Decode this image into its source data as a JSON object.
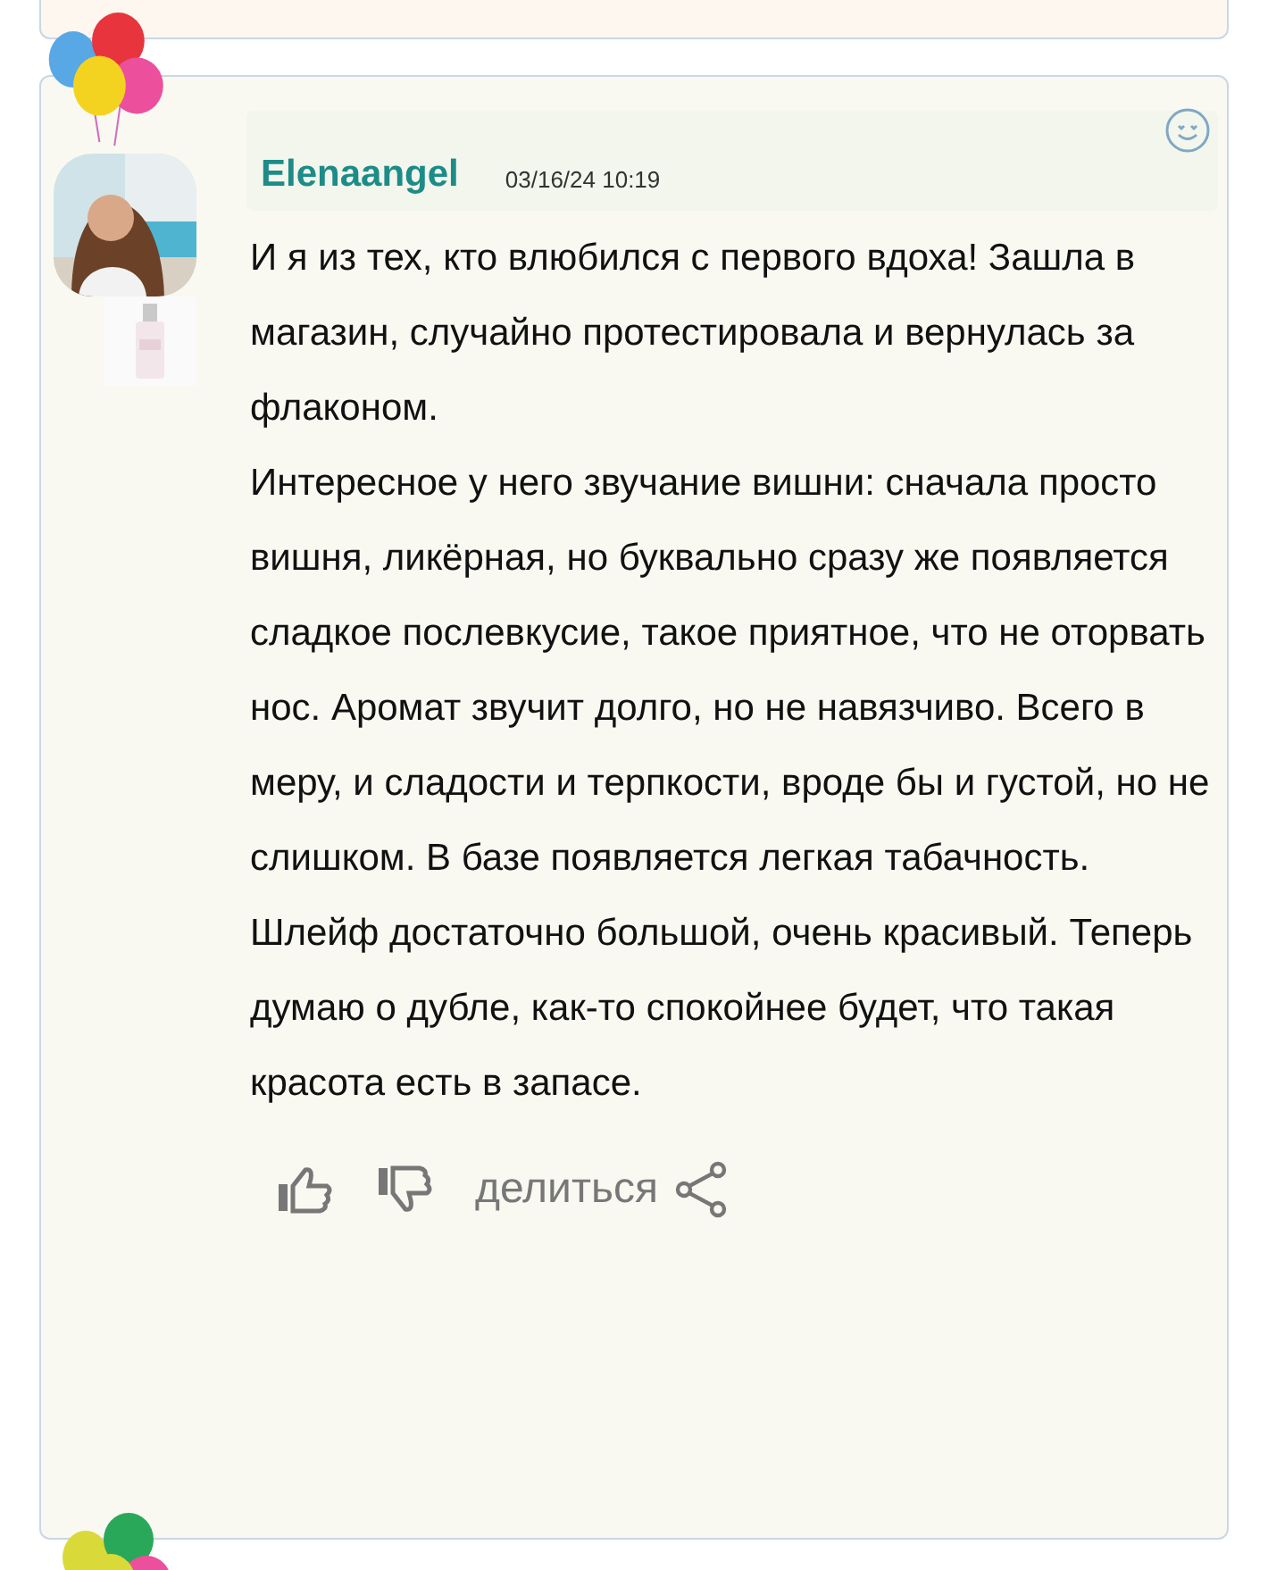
{
  "comment": {
    "author": "Elenaangel",
    "date": "03/16/24 10:19",
    "paragraphs": [
      "И я из тех, кто влюбился с первого вдоха! Зашла в магазин, случайно протестировала и вернулась за флаконом.",
      "Интересное у него звучание вишни: сначала просто вишня, ликёрная, но буквально сразу же появляется сладкое послевкусие, такое приятное, что не оторвать нос. Аромат звучит долго, но не навязчиво. Всего в меру, и сладости и терпкости, вроде бы и густой, но не слишком. В базе появляется легкая табачность. Шлейф достаточно большой, очень красивый. Теперь думаю о дубле, как-то спокойнее будет, что такая красота есть в запасе."
    ],
    "share_label": "делиться"
  }
}
